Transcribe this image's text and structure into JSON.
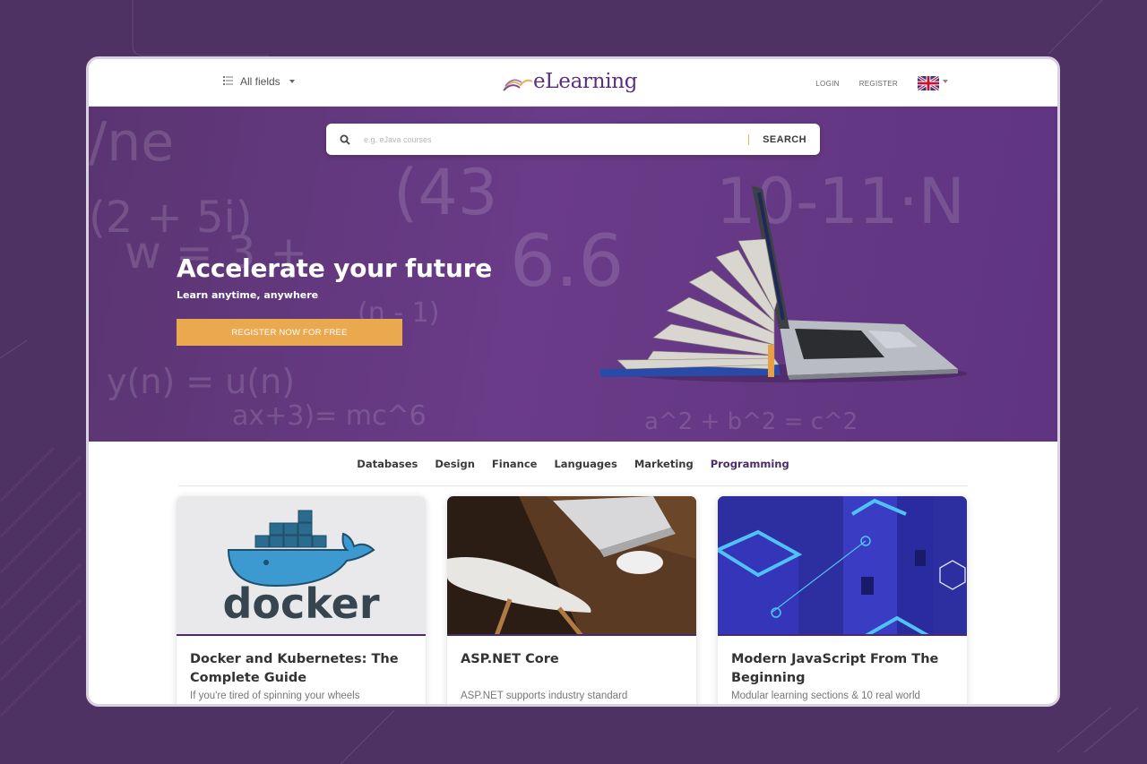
{
  "colors": {
    "background": "#4e3263",
    "hero": "#6a3b88",
    "accent": "#eaa94f",
    "brand": "#5b2f7e"
  },
  "header": {
    "fields_label": "All fields",
    "logo_text": "eLearning",
    "login": "LOGIN",
    "register": "REGISTER",
    "language_icon": "uk-flag-icon"
  },
  "search": {
    "placeholder": "e.g. eJava courses",
    "button": "SEARCH"
  },
  "hero": {
    "headline": "Accelerate your future",
    "subline": "Learn anytime, anywhere",
    "cta": "REGISTER NOW FOR FREE"
  },
  "categories": [
    "Databases",
    "Design",
    "Finance",
    "Languages",
    "Marketing",
    "Programming"
  ],
  "courses": [
    {
      "title": "Docker and Kubernetes: The Complete Guide",
      "desc": "If you're tired of spinning your wheels",
      "thumb_text": "docker"
    },
    {
      "title": "ASP.NET Core",
      "desc": "ASP.NET supports industry standard"
    },
    {
      "title": "Modern JavaScript From The Beginning",
      "desc": "Modular learning sections & 10 real world"
    }
  ]
}
